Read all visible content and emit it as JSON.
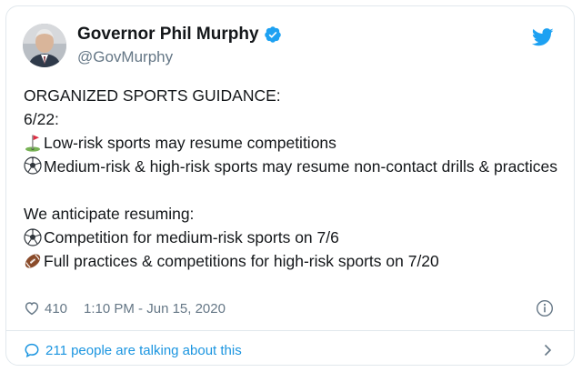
{
  "tweet": {
    "author": {
      "display_name": "Governor Phil Murphy",
      "handle": "@GovMurphy",
      "verified": true
    },
    "lines": {
      "l1": "ORGANIZED SPORTS GUIDANCE:",
      "l2": "6/22:",
      "l3": "Low-risk sports may resume competitions",
      "l4": "Medium-risk & high-risk sports may resume non-contact drills & practices",
      "l5": "We anticipate resuming:",
      "l6": "Competition for medium-risk sports on 7/6",
      "l7": "Full practices & competitions for high-risk sports on 7/20"
    },
    "emojis": {
      "l3": "golf-flag-icon",
      "l4": "soccer-ball-icon",
      "l6": "soccer-ball-icon",
      "l7": "football-icon"
    },
    "likes": "410",
    "timestamp": "1:10 PM - Jun 15, 2020",
    "talking": "211 people are talking about this"
  },
  "colors": {
    "accent": "#1da1f2",
    "link": "#1b95e0",
    "text": "#14171a",
    "muted": "#657786",
    "border": "#e1e8ed"
  }
}
